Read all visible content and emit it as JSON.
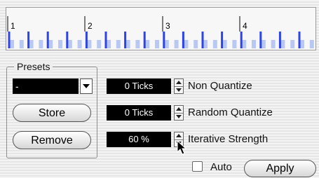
{
  "ruler": {
    "bar_labels": [
      "1",
      "2",
      "3",
      "4"
    ],
    "colors": {
      "tick": "#2f44e6",
      "tick_light": "#b9c8f2",
      "bar_line": "#000000"
    }
  },
  "presets": {
    "legend": "Presets",
    "selected": "-",
    "store_label": "Store",
    "remove_label": "Remove"
  },
  "rows": [
    {
      "value": "0 Ticks",
      "label": "Non Quantize"
    },
    {
      "value": "0 Ticks",
      "label": "Random Quantize"
    },
    {
      "value": "60 %",
      "label": "Iterative Strength"
    }
  ],
  "footer": {
    "auto_label": "Auto",
    "auto_checked": false,
    "apply_label": "Apply"
  },
  "icons": [
    "dropdown-arrow-icon",
    "spin-up-icon",
    "spin-down-icon",
    "mouse-pointer-icon"
  ]
}
